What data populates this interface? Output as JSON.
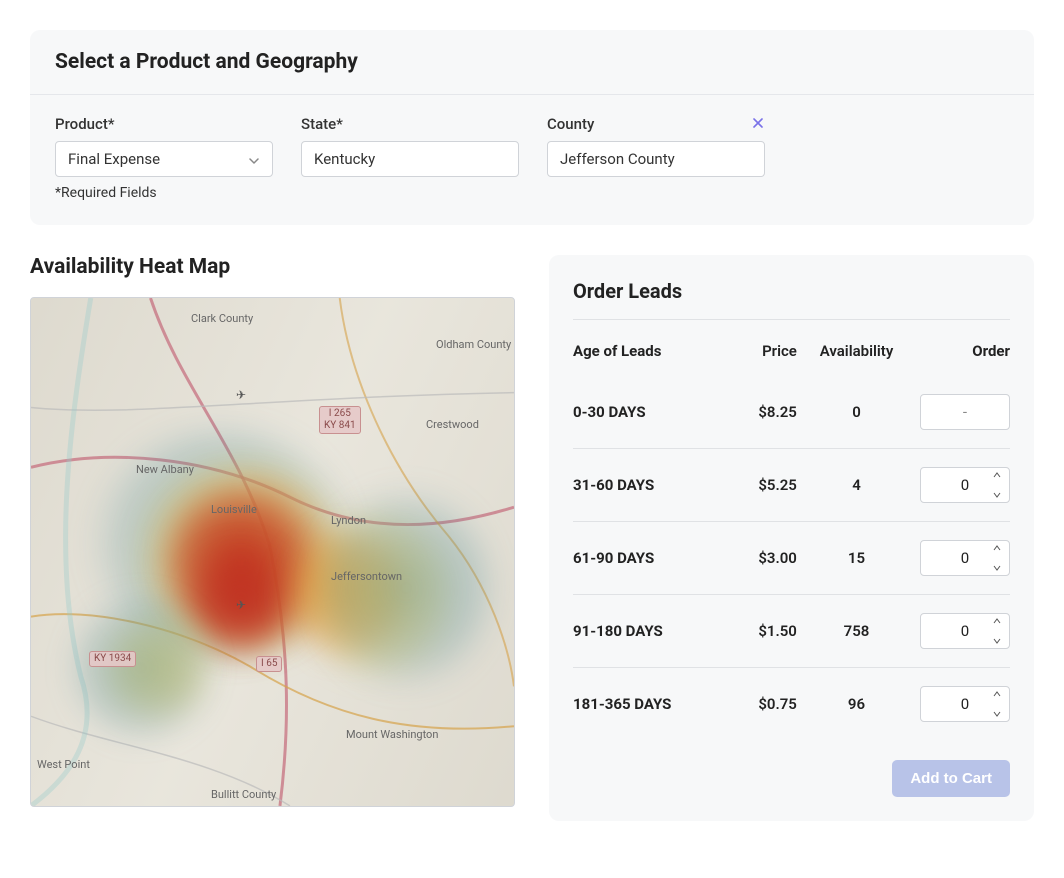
{
  "filter": {
    "title": "Select a Product and Geography",
    "product_label": "Product*",
    "product_value": "Final Expense",
    "state_label": "State*",
    "state_value": "Kentucky",
    "county_label": "County",
    "county_value": "Jefferson County",
    "required_note": "*Required Fields"
  },
  "heatmap": {
    "title": "Availability Heat Map",
    "labels": {
      "clark": "Clark County",
      "oldham": "Oldham County",
      "crestwood": "Crestwood",
      "newalbany": "New Albany",
      "louisville": "Louisville",
      "lyndon": "Lyndon",
      "jeffersontown": "Jeffersontown",
      "mtwash": "Mount Washington",
      "westpoint": "West Point",
      "bullitt": "Bullitt County"
    },
    "badges": {
      "i265": "I 265\nKY 841",
      "ky1934": "KY 1934",
      "i65": "I 65"
    }
  },
  "order": {
    "title": "Order Leads",
    "columns": {
      "age": "Age of Leads",
      "price": "Price",
      "availability": "Availability",
      "order": "Order"
    },
    "rows": [
      {
        "age": "0-30 DAYS",
        "price": "$8.25",
        "availability": "0",
        "order": "-",
        "disabled": true
      },
      {
        "age": "31-60 DAYS",
        "price": "$5.25",
        "availability": "4",
        "order": "0",
        "disabled": false
      },
      {
        "age": "61-90 DAYS",
        "price": "$3.00",
        "availability": "15",
        "order": "0",
        "disabled": false
      },
      {
        "age": "91-180 DAYS",
        "price": "$1.50",
        "availability": "758",
        "order": "0",
        "disabled": false
      },
      {
        "age": "181-365 DAYS",
        "price": "$0.75",
        "availability": "96",
        "order": "0",
        "disabled": false
      }
    ],
    "add_to_cart": "Add to Cart"
  }
}
